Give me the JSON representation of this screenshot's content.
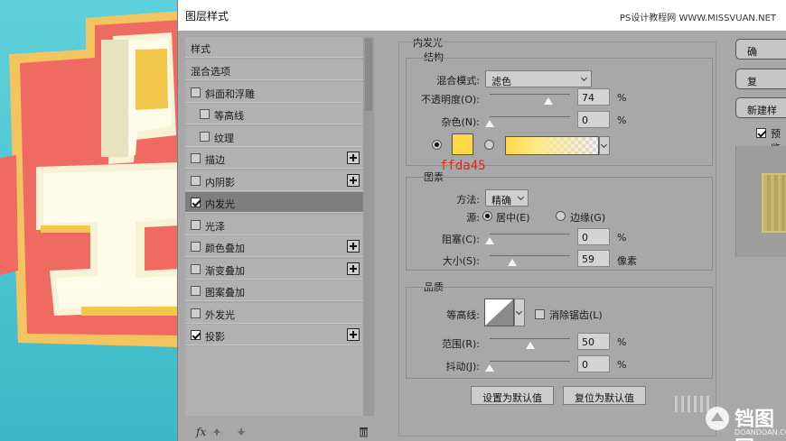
{
  "dialog": {
    "title": "图层样式",
    "watermark": "PS设计教程网 WWW.MISSVUAN.NET"
  },
  "style_list": [
    {
      "label": "样式",
      "type": "header"
    },
    {
      "label": "混合选项",
      "type": "header"
    },
    {
      "label": "斜面和浮雕",
      "checked": false,
      "plus": false,
      "indent": false
    },
    {
      "label": "等高线",
      "checked": false,
      "plus": false,
      "indent": true
    },
    {
      "label": "纹理",
      "checked": false,
      "plus": false,
      "indent": true
    },
    {
      "label": "描边",
      "checked": false,
      "plus": true,
      "indent": false
    },
    {
      "label": "内阴影",
      "checked": false,
      "plus": true,
      "indent": false
    },
    {
      "label": "内发光",
      "checked": true,
      "plus": false,
      "indent": false,
      "selected": true
    },
    {
      "label": "光泽",
      "checked": false,
      "plus": false,
      "indent": false
    },
    {
      "label": "颜色叠加",
      "checked": false,
      "plus": true,
      "indent": false
    },
    {
      "label": "渐变叠加",
      "checked": false,
      "plus": true,
      "indent": false
    },
    {
      "label": "图案叠加",
      "checked": false,
      "plus": false,
      "indent": false
    },
    {
      "label": "外发光",
      "checked": false,
      "plus": false,
      "indent": false
    },
    {
      "label": "投影",
      "checked": true,
      "plus": true,
      "indent": false
    }
  ],
  "fx_label": "fx",
  "inner_glow": {
    "title": "内发光",
    "structure": {
      "title": "结构",
      "blend_mode_label": "混合模式:",
      "blend_mode_value": "滤色",
      "opacity_label": "不透明度(O):",
      "opacity_value": "74",
      "opacity_unit": "%",
      "opacity_level": 74,
      "noise_label": "杂色(N):",
      "noise_value": "0",
      "noise_unit": "%",
      "noise_level": 0,
      "color_hex": "#ffda45",
      "color_annotation": "ffda45"
    },
    "elements": {
      "title": "图素",
      "method_label": "方法:",
      "method_value": "精确",
      "source_label": "源:",
      "source_center": "居中(E)",
      "source_edge": "边缘(G)",
      "choke_label": "阻塞(C):",
      "choke_value": "0",
      "choke_unit": "%",
      "choke_level": 0,
      "size_label": "大小(S):",
      "size_value": "59",
      "size_unit": "像素",
      "size_level": 23.6
    },
    "quality": {
      "title": "品质",
      "contour_label": "等高线:",
      "antialias_label": "消除锯齿(L)",
      "range_label": "范围(R):",
      "range_value": "50",
      "range_unit": "%",
      "range_level": 50,
      "jitter_label": "抖动(J):",
      "jitter_value": "0",
      "jitter_unit": "%",
      "jitter_level": 0
    },
    "make_default": "设置为默认值",
    "reset_default": "复位为默认值"
  },
  "right_buttons": {
    "ok": "确",
    "reset": "复",
    "new_style": "新建样",
    "preview": "预览"
  },
  "bottom_watermark": {
    "brand": "铛图网",
    "url": "DOANDOAN.COM"
  },
  "colors": {
    "glow_color": "#ffda45",
    "annotation_red": "#e0261e",
    "selected_row": "#7f7f7f"
  }
}
